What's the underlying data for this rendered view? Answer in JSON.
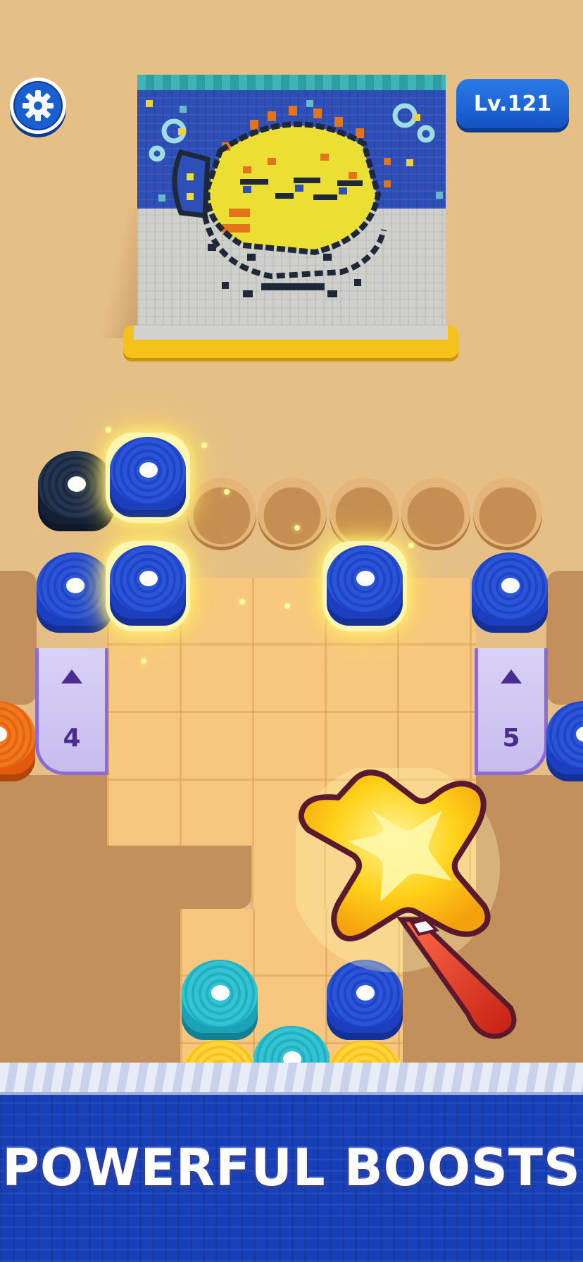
{
  "hud": {
    "settings_icon": "gear-icon",
    "level_label": "Lv.121"
  },
  "tapestry": {
    "subject": "pufferfish pixel knit picture"
  },
  "board": {
    "tunnel_left": {
      "arrow_icon": "triangle-up-icon",
      "count": "4"
    },
    "tunnel_right": {
      "arrow_icon": "triangle-up-icon",
      "count": "5"
    },
    "empty_slots": 5
  },
  "colors": {
    "background": "#e6bf86",
    "accent_blue": "#1a5fd0",
    "yarn_blue": "#1c3fbf",
    "yarn_dark": "#121f35",
    "yarn_cyan": "#1aa3b8",
    "yarn_orange": "#e35a0c",
    "yarn_yellow": "#f0b90e",
    "wand_star": "#ffd21a",
    "wand_handle": "#d8331f"
  },
  "boost": {
    "icon": "magic-wand-star-icon"
  },
  "banner": {
    "title": "POWERFUL BOOSTS"
  }
}
